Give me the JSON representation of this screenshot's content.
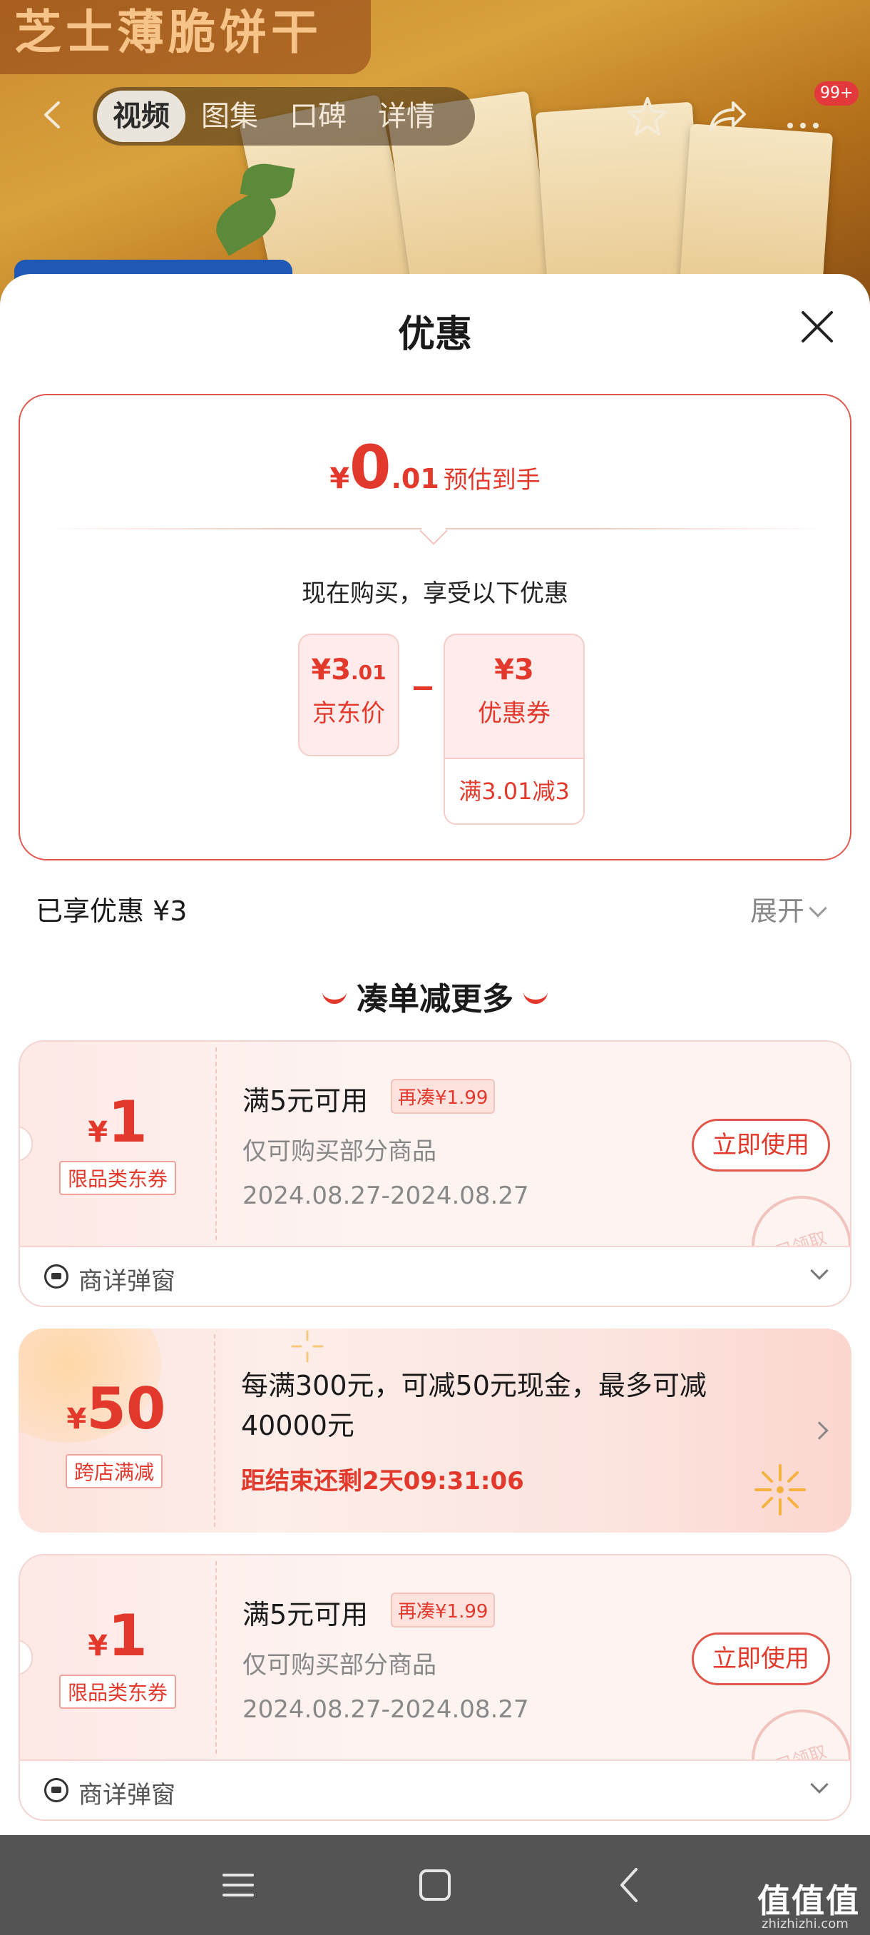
{
  "hero": {
    "title": "芝士薄脆饼干",
    "tabs": [
      "视频",
      "图集",
      "口碑",
      "详情"
    ],
    "active_tab": 0,
    "badge": "99+"
  },
  "sheet": {
    "title": "优惠",
    "estimate": {
      "yen": "¥",
      "int": "0",
      "dec": ".01",
      "label": "预估到手"
    },
    "now_buy": "现在购买，享受以下优惠",
    "jd_price": {
      "yen": "¥",
      "int": "3",
      "dec": ".01",
      "label": "京东价"
    },
    "coupon_box": {
      "yen": "¥",
      "int": "3",
      "label": "优惠券",
      "condition": "满3.01减3"
    },
    "enjoyed": "已享优惠 ¥3",
    "expand": "展开",
    "more_title": "凑单减更多"
  },
  "coupons": [
    {
      "yen": "¥",
      "amount": "1",
      "tag": "限品类东券",
      "title": "满5元可用",
      "extra": "再凑¥1.99",
      "sub": "仅可购买部分商品",
      "date": "2024.08.27-2024.08.27",
      "button": "立即使用",
      "stamp": "已领取",
      "footer": "商详弹窗"
    },
    {
      "yen": "¥",
      "amount": "50",
      "tag": "跨店满减",
      "desc": "每满300元，可减50元现金，最多可减40000元",
      "countdown": "距结束还剩2天09:31:06"
    },
    {
      "yen": "¥",
      "amount": "1",
      "tag": "限品类东券",
      "title": "满5元可用",
      "extra": "再凑¥1.99",
      "sub": "仅可购买部分商品",
      "date": "2024.08.27-2024.08.27",
      "button": "立即使用",
      "stamp": "已领取",
      "footer": "商详弹窗"
    }
  ],
  "watermark": {
    "text": "值值值",
    "sub": "zhizhizhi.com"
  },
  "colors": {
    "accent": "#e2392c",
    "navbar": "#545454"
  }
}
